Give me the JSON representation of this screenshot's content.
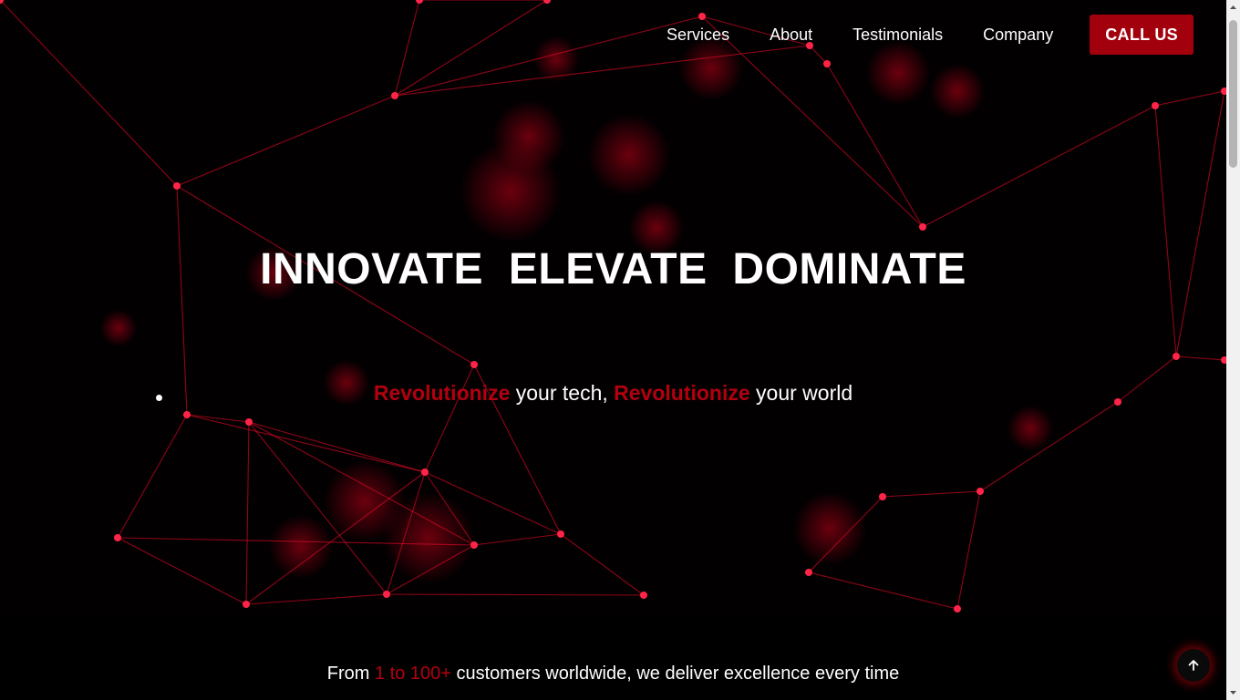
{
  "nav": {
    "items": [
      {
        "label": "Services"
      },
      {
        "label": "About"
      },
      {
        "label": "Testimonials"
      },
      {
        "label": "Company"
      }
    ],
    "cta_label": "CALL US"
  },
  "hero": {
    "headline": "INNOVATE ELEVATE DOMINATE",
    "tagline": {
      "word1": "Revolutionize",
      "mid": " your tech, ",
      "word2": "Revolutionize",
      "end": " your world"
    },
    "background_icon": "particle-network"
  },
  "stats": {
    "prefix": "From ",
    "highlight": "1 to 100+",
    "suffix": " customers worldwide, we deliver excellence every time"
  },
  "back_to_top_icon": "arrow-up-icon",
  "colors": {
    "accent": "#b3000f",
    "cta_bg": "#a3000e",
    "network_line": "#ff0a2e",
    "background": "#000000"
  }
}
